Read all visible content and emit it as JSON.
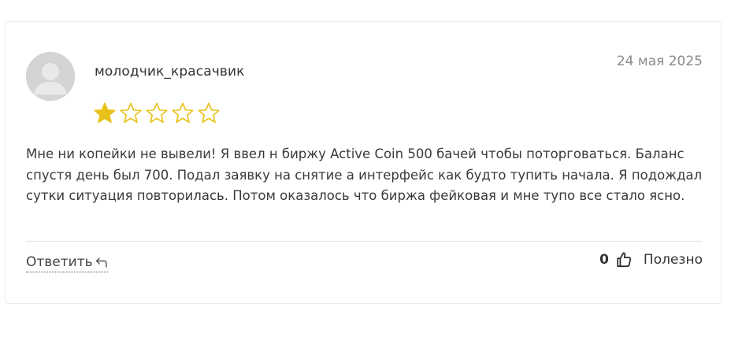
{
  "review": {
    "username": "молодчик_красачвик",
    "date": "24 мая 2025",
    "rating": 1,
    "rating_max": 5,
    "text": "Мне ни копейки не вывели! Я ввел н биржу Active Coin 500 бачей чтобы поторговаться. Баланс спустя день был 700. Подал заявку на снятие а интерфейс как будто тупить начала. Я подождал сутки ситуация повторилась. Потом оказалось что биржа фейковая и мне тупо все стало ясно.",
    "reply_label": "Ответить",
    "helpful_count": "0",
    "helpful_label": "Полезно"
  },
  "icons": {
    "avatar": "user-placeholder-icon",
    "star_filled": "star-filled-icon",
    "star_empty": "star-outline-icon",
    "reply": "reply-arrow-icon",
    "thumb": "thumbs-up-icon"
  },
  "colors": {
    "star": "#e8c21a",
    "text": "#3a3a3a",
    "muted": "#8a8a8a",
    "border": "#ececec"
  }
}
